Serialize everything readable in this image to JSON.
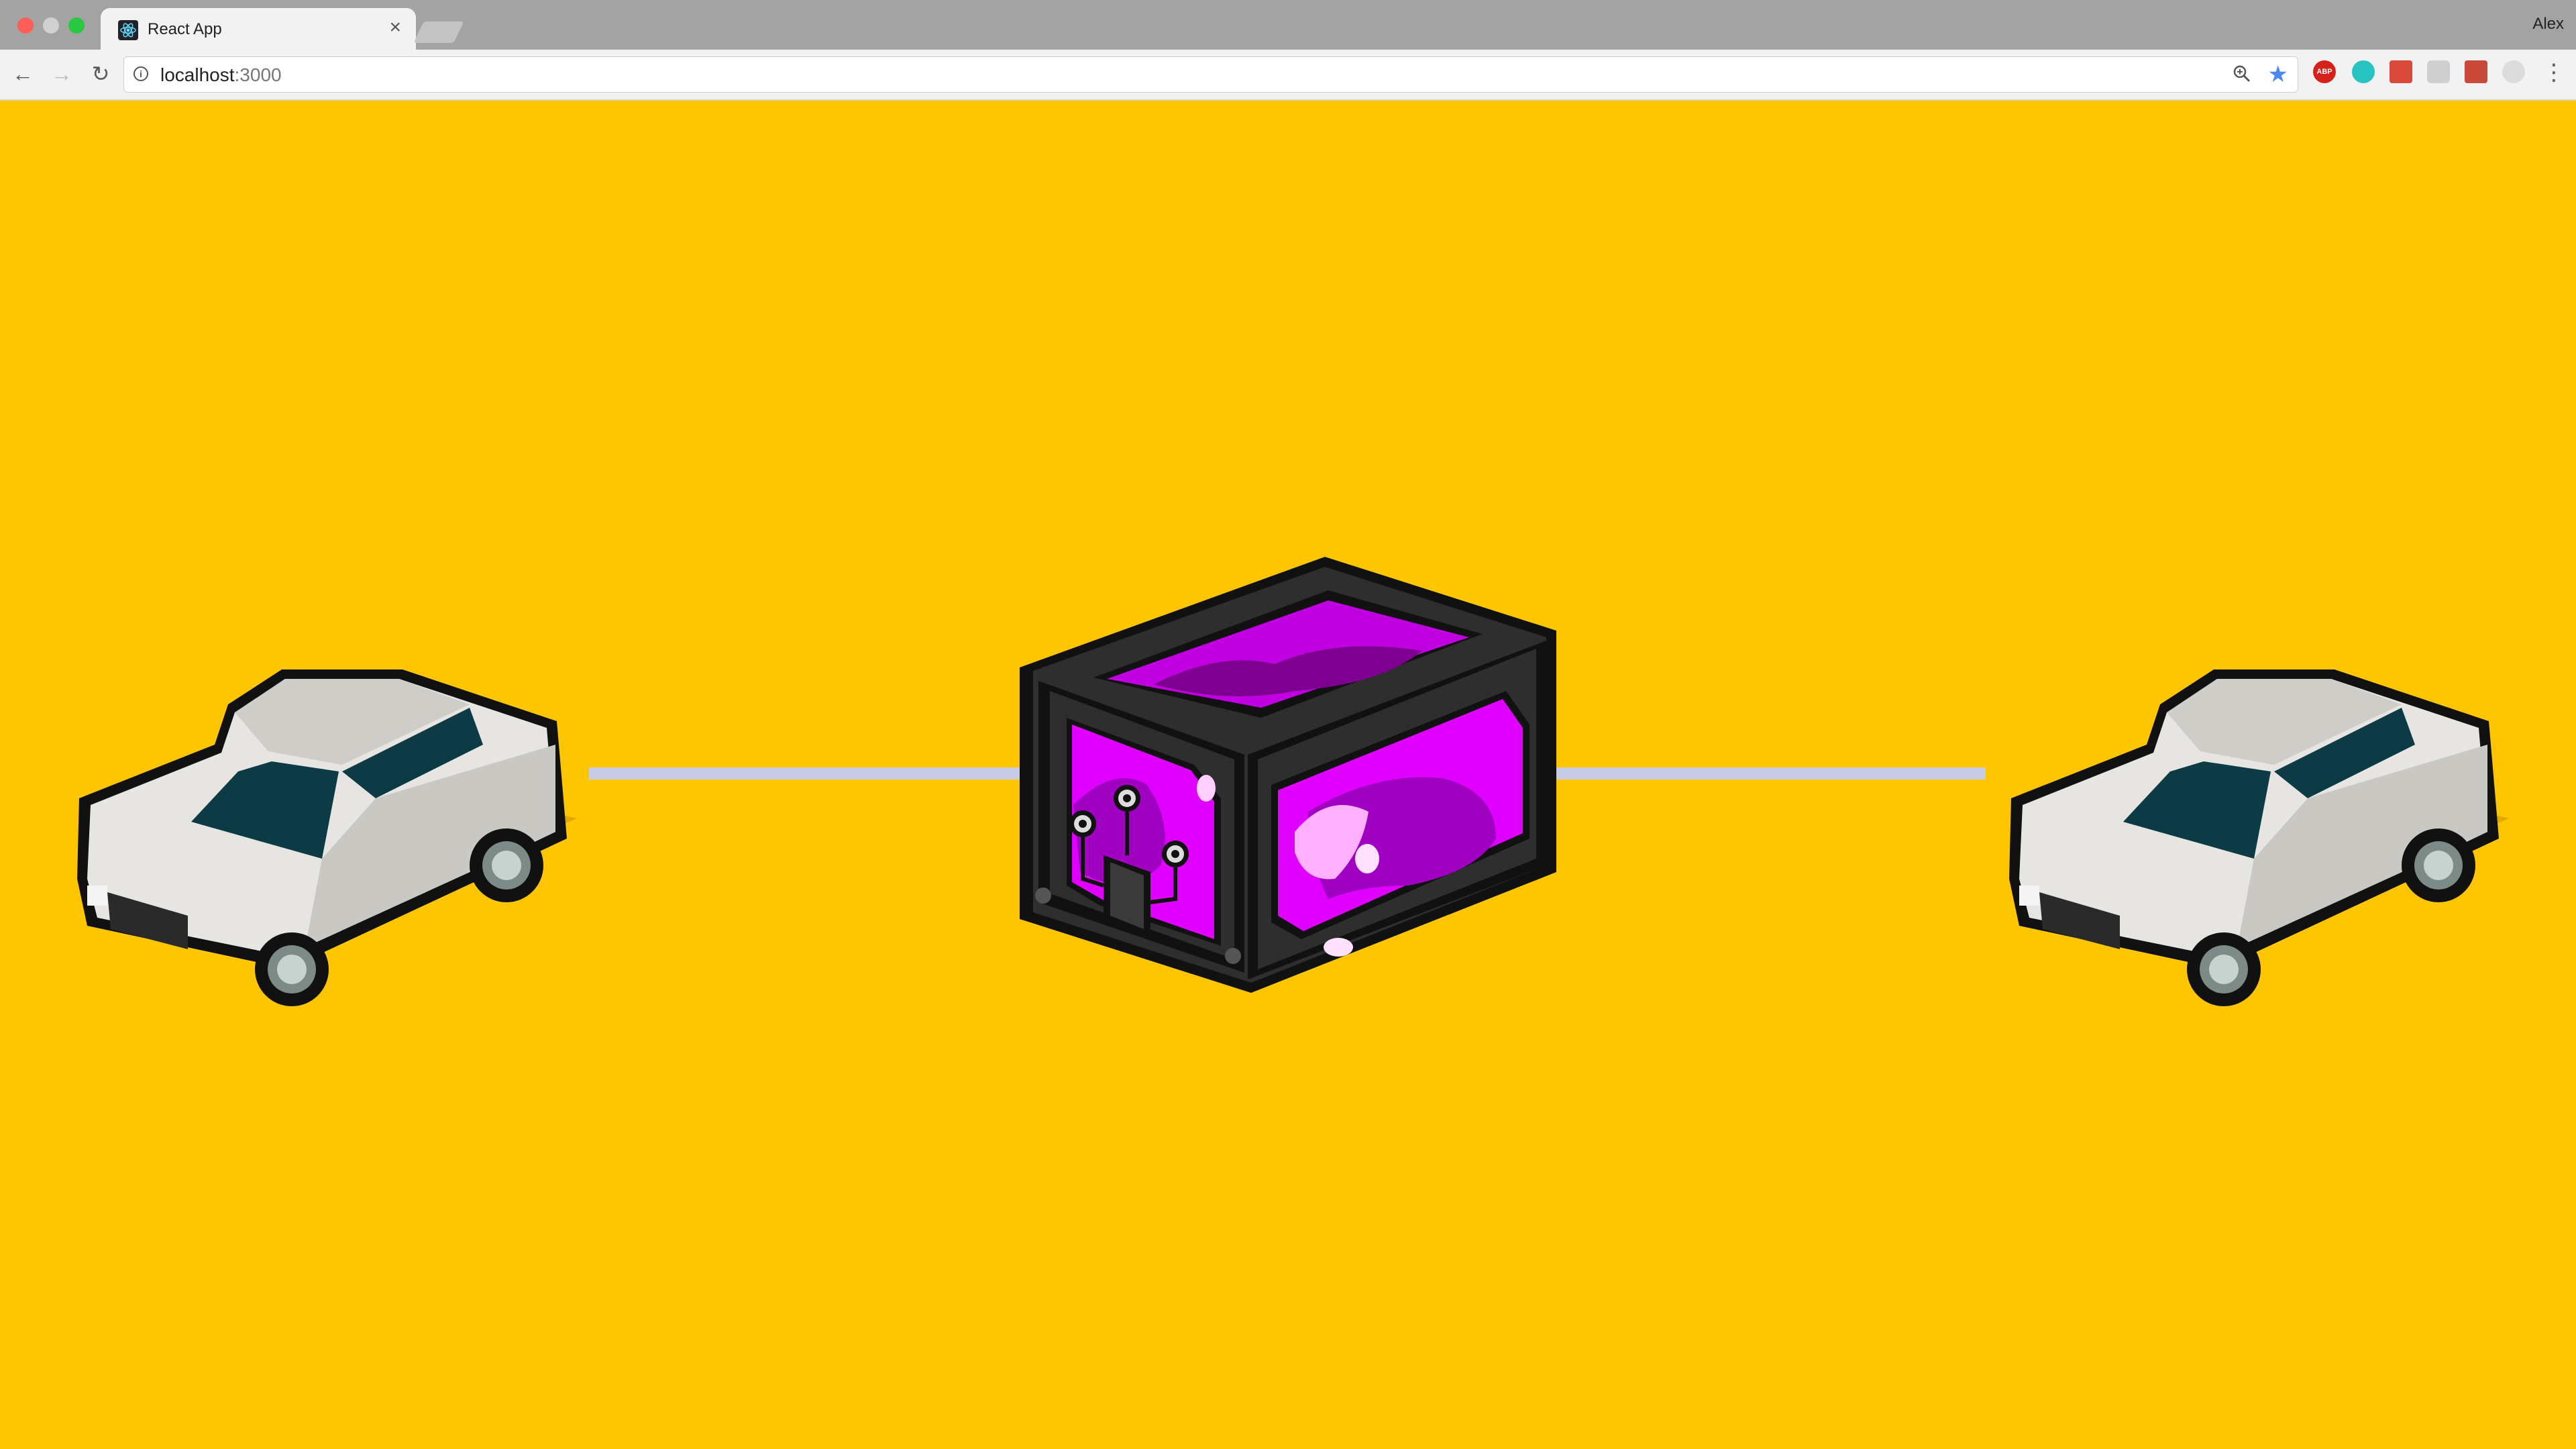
{
  "browser": {
    "tab_title": "React App",
    "tab_close": "×",
    "profile": "Alex",
    "url_host": "localhost",
    "url_port": ":3000",
    "extensions": {
      "abp_label": "ABP"
    }
  },
  "page": {
    "background_color": "#fec601",
    "connector_color": "#c7cbe3",
    "box_color": "#e000ff",
    "icons": [
      "car-left",
      "portal-box",
      "car-right"
    ]
  }
}
